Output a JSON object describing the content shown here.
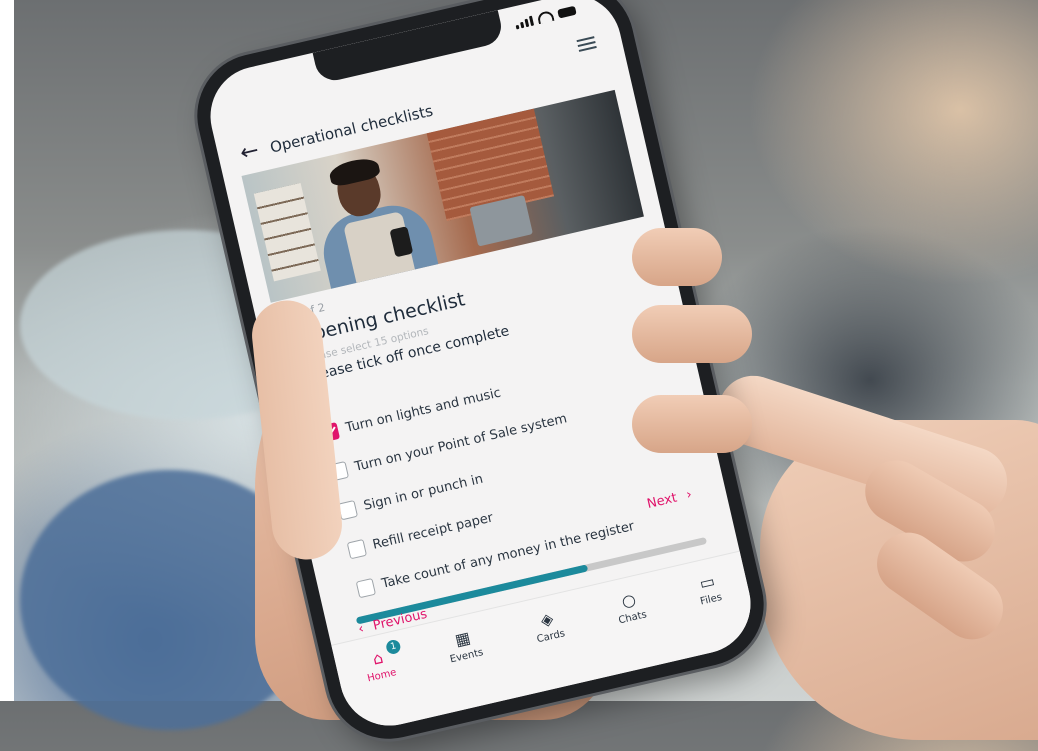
{
  "header": {
    "title": "Operational checklists"
  },
  "checklist": {
    "step": "2 of 2",
    "title": "Opening checklist",
    "hint": "Please select 15 options",
    "instruction": "Please tick off once complete",
    "items": [
      {
        "label": "Turn on lights and music",
        "checked": true
      },
      {
        "label": "Turn on your Point of Sale system",
        "checked": false
      },
      {
        "label": "Sign in or punch in",
        "checked": false
      },
      {
        "label": "Refill receipt paper",
        "checked": false
      },
      {
        "label": "Take count of any money in the register",
        "checked": false
      }
    ]
  },
  "navigation": {
    "next_label": "Next",
    "previous_label": "Previous",
    "progress": 0.66
  },
  "tabs": [
    {
      "label": "Home",
      "icon": "home-icon",
      "badge": "1",
      "active": true
    },
    {
      "label": "Events",
      "icon": "calendar-icon"
    },
    {
      "label": "Cards",
      "icon": "stack-icon"
    },
    {
      "label": "Chats",
      "icon": "chat-bubble-icon"
    },
    {
      "label": "Files",
      "icon": "folder-icon"
    }
  ],
  "colors": {
    "accent": "#e0146b",
    "progress": "#1c8a9c",
    "text": "#1e2b3a"
  }
}
